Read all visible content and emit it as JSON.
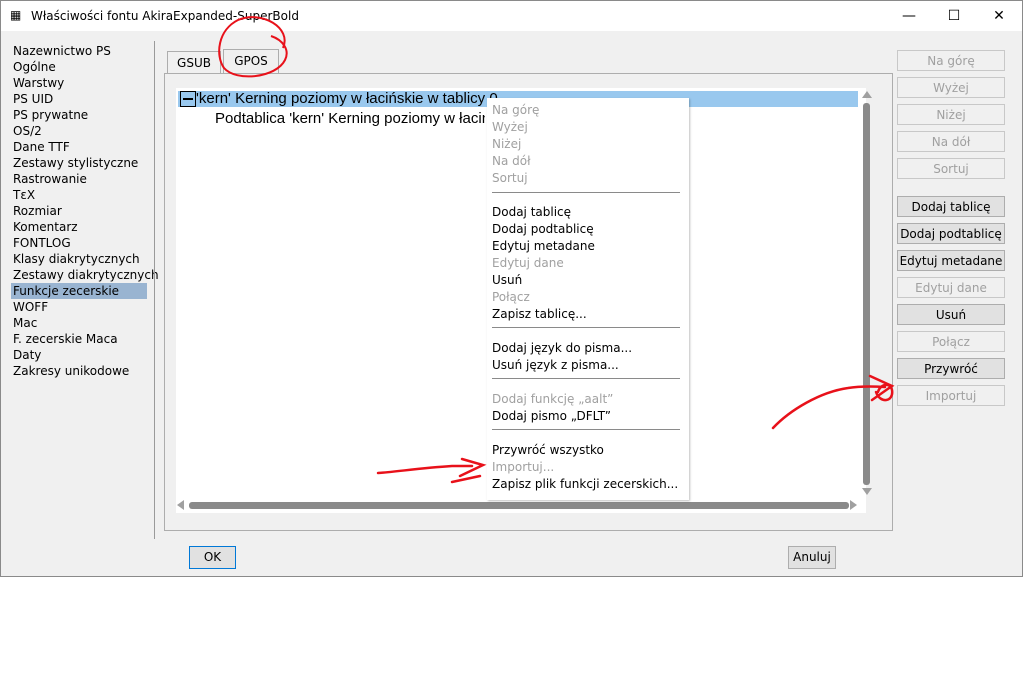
{
  "window": {
    "title": "Właściwości fontu AkiraExpanded-SuperBold",
    "controls": {
      "minimize": "—",
      "maximize": "☐",
      "close": "✕"
    }
  },
  "nav": {
    "items": [
      "Nazewnictwo PS",
      "Ogólne",
      "Warstwy",
      "PS UID",
      "PS prywatne",
      "OS/2",
      "Dane TTF",
      "Zestawy stylistyczne",
      "Rastrowanie",
      "TεX",
      "Rozmiar",
      "Komentarz",
      "FONTLOG",
      "Klasy diakrytycznych",
      "Zestawy diakrytycznych",
      "Funkcje zecerskie",
      "WOFF",
      "Mac",
      "F. zecerskie Maca",
      "Daty",
      "Zakresy unikodowe"
    ],
    "selected_index": 15
  },
  "tabs": {
    "gsub": "GSUB",
    "gpos": "GPOS",
    "active": "GPOS"
  },
  "tree": {
    "row1": "'kern' Kerning poziomy w łacińskie w tablicy 0",
    "row2": "Podtablica 'kern' Kerning poziomy w łacińskie w tablicy 0"
  },
  "context_menu": {
    "items": [
      {
        "label": "Na górę",
        "enabled": false
      },
      {
        "label": "Wyżej",
        "enabled": false
      },
      {
        "label": "Niżej",
        "enabled": false
      },
      {
        "label": "Na dół",
        "enabled": false
      },
      {
        "label": "Sortuj",
        "enabled": false
      },
      {
        "label": "Dodaj tablicę",
        "enabled": true
      },
      {
        "label": "Dodaj podtablicę",
        "enabled": true
      },
      {
        "label": "Edytuj metadane",
        "enabled": true
      },
      {
        "label": "Edytuj dane",
        "enabled": false
      },
      {
        "label": "Usuń",
        "enabled": true
      },
      {
        "label": "Połącz",
        "enabled": false
      },
      {
        "label": "Zapisz tablicę...",
        "enabled": true
      },
      {
        "label": "Dodaj język do pisma...",
        "enabled": true
      },
      {
        "label": "Usuń język z pisma...",
        "enabled": true
      },
      {
        "label": "Dodaj funkcję „aalt”",
        "enabled": false
      },
      {
        "label": "Dodaj pismo „DFLT”",
        "enabled": true
      },
      {
        "label": "Przywróć wszystko",
        "enabled": true
      },
      {
        "label": "Importuj...",
        "enabled": false
      },
      {
        "label": "Zapisz plik funkcji zecerskich...",
        "enabled": true
      }
    ]
  },
  "side_buttons": [
    {
      "label": "Na górę",
      "enabled": false
    },
    {
      "label": "Wyżej",
      "enabled": false
    },
    {
      "label": "Niżej",
      "enabled": false
    },
    {
      "label": "Na dół",
      "enabled": false
    },
    {
      "label": "Sortuj",
      "enabled": false
    },
    {
      "label": "Dodaj tablicę",
      "enabled": true
    },
    {
      "label": "Dodaj podtablicę",
      "enabled": true
    },
    {
      "label": "Edytuj metadane",
      "enabled": true
    },
    {
      "label": "Edytuj dane",
      "enabled": false
    },
    {
      "label": "Usuń",
      "enabled": true
    },
    {
      "label": "Połącz",
      "enabled": false
    },
    {
      "label": "Przywróć",
      "enabled": true
    },
    {
      "label": "Importuj",
      "enabled": false
    }
  ],
  "footer": {
    "ok": "OK",
    "cancel": "Anuluj"
  },
  "annotation_color": "#e8111a"
}
